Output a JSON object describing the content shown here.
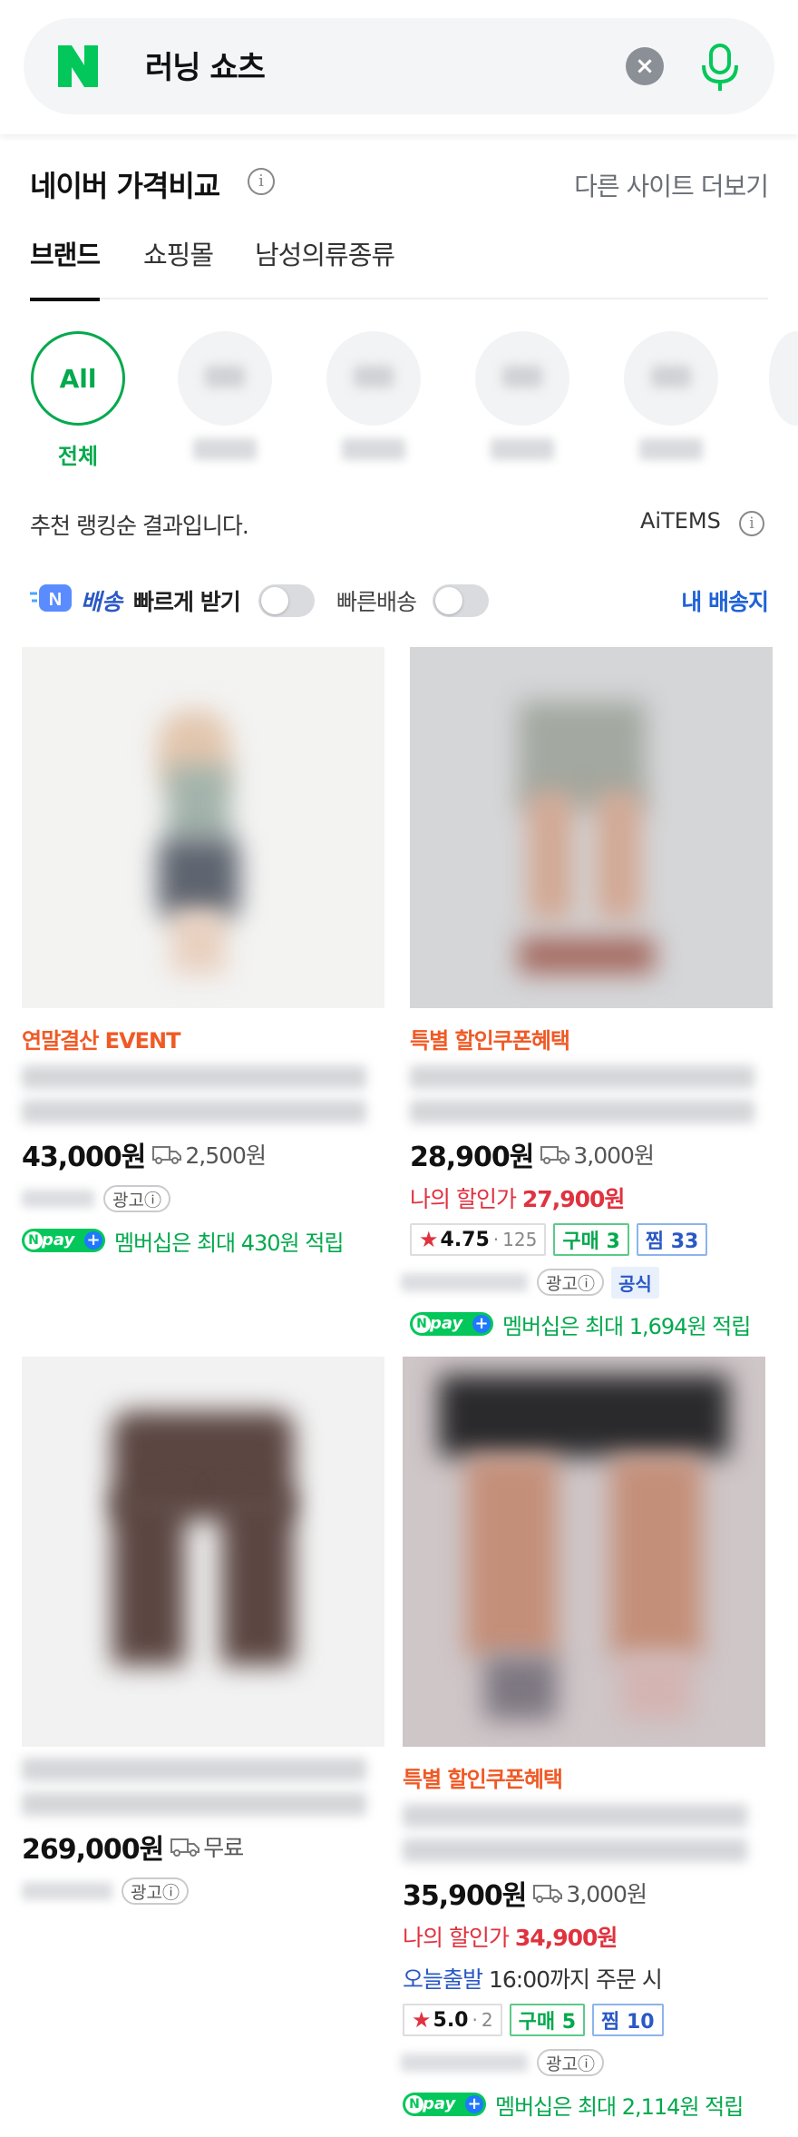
{
  "search": {
    "query": "러닝 쇼츠"
  },
  "section": {
    "title": "네이버 가격비교",
    "more_link": "다른 사이트 더보기"
  },
  "tabs": [
    {
      "label": "브랜드",
      "active": true
    },
    {
      "label": "쇼핑몰",
      "active": false
    },
    {
      "label": "남성의류종류",
      "active": false
    }
  ],
  "brands": {
    "all_circle": "All",
    "all_label": "전체"
  },
  "ranking": {
    "text": "추천 랭킹순 결과입니다.",
    "aitems": "AiTEMS"
  },
  "delivery": {
    "deliv_label": "배송",
    "fast_label": "빠르게 받기",
    "fast2_label": "빠른배송",
    "my_address": "내 배송지"
  },
  "products": [
    {
      "promo": "연말결산 EVENT",
      "price": "43,000원",
      "shipping": "2,500원",
      "ad": "광고ⓘ",
      "npay": "멤버십은 최대 430원 적립"
    },
    {
      "promo": "특별 할인쿠폰혜택",
      "price": "28,900원",
      "shipping": "3,000원",
      "discount_label": "나의 할인가",
      "discount_price": "27,900원",
      "rating": "4.75",
      "review_count": "125",
      "buy": "구매 3",
      "zzim": "찜 33",
      "ad": "광고ⓘ",
      "official": "공식",
      "npay": "멤버십은 최대 1,694원 적립"
    },
    {
      "price": "269,000원",
      "shipping": "무료",
      "ad": "광고ⓘ"
    },
    {
      "promo": "특별 할인쿠폰혜택",
      "price": "35,900원",
      "shipping": "3,000원",
      "discount_label": "나의 할인가",
      "discount_price": "34,900원",
      "today_label": "오늘출발",
      "today_text": "16:00까지 주문 시",
      "rating": "5.0",
      "review_count": "2",
      "buy": "구매 5",
      "zzim": "찜 10",
      "ad": "광고ⓘ",
      "npay": "멤버십은 최대 2,114원 적립"
    }
  ],
  "npay_pill": "pay",
  "colors": {
    "naver_green": "#03c75a",
    "accent_blue": "#2a58c6",
    "discount_red": "#e0323f",
    "promo_orange": "#f05a26"
  }
}
